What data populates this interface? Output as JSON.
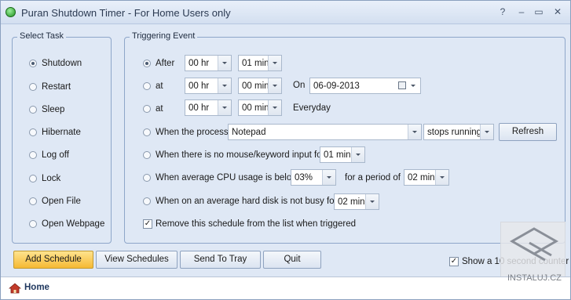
{
  "window": {
    "title": "Puran Shutdown Timer - For Home Users only",
    "buttons": {
      "help": "?",
      "minimize": "–",
      "restore": "▭",
      "close": "✕"
    }
  },
  "select_task": {
    "legend": "Select Task",
    "items": [
      {
        "label": "Shutdown",
        "selected": true
      },
      {
        "label": "Restart",
        "selected": false
      },
      {
        "label": "Sleep",
        "selected": false
      },
      {
        "label": "Hibernate",
        "selected": false
      },
      {
        "label": "Log off",
        "selected": false
      },
      {
        "label": "Lock",
        "selected": false
      },
      {
        "label": "Open File",
        "selected": false
      },
      {
        "label": "Open Webpage",
        "selected": false
      }
    ]
  },
  "triggering_event": {
    "legend": "Triggering Event",
    "after": {
      "label": "After",
      "hours": "00 hr",
      "minutes": "01 min",
      "selected": true
    },
    "at_on": {
      "label": "at",
      "hours": "00 hr",
      "minutes": "00 min",
      "on_label": "On",
      "date": "06-09-2013"
    },
    "at_everyday": {
      "label": "at",
      "hours": "00 hr",
      "minutes": "00 min",
      "everyday_label": "Everyday"
    },
    "process": {
      "label": "When the process",
      "name": "Notepad",
      "condition": "stops running",
      "refresh": "Refresh"
    },
    "no_input": {
      "label": "When there is no mouse/keyword input for",
      "minutes": "01 min"
    },
    "cpu": {
      "label": "When average CPU usage is below",
      "percent": "03%",
      "period_label": "for a period of",
      "minutes": "02 min"
    },
    "disk": {
      "label": "When on an average hard disk is not busy for",
      "minutes": "02 min"
    },
    "remove_checkbox": {
      "label": "Remove this schedule from the list when triggered",
      "checked": true
    }
  },
  "actions": {
    "add": "Add Schedule",
    "view": "View Schedules",
    "tray": "Send To Tray",
    "quit": "Quit",
    "counter_checkbox": {
      "label": "Show a 10 second counter",
      "checked": true
    }
  },
  "statusbar": {
    "home": "Home"
  },
  "watermark": {
    "text": "INSTALUJ.CZ"
  },
  "colors": {
    "accent": "#f5b934",
    "panel_border": "#8ea6c9",
    "background": "#dfe8f5"
  }
}
